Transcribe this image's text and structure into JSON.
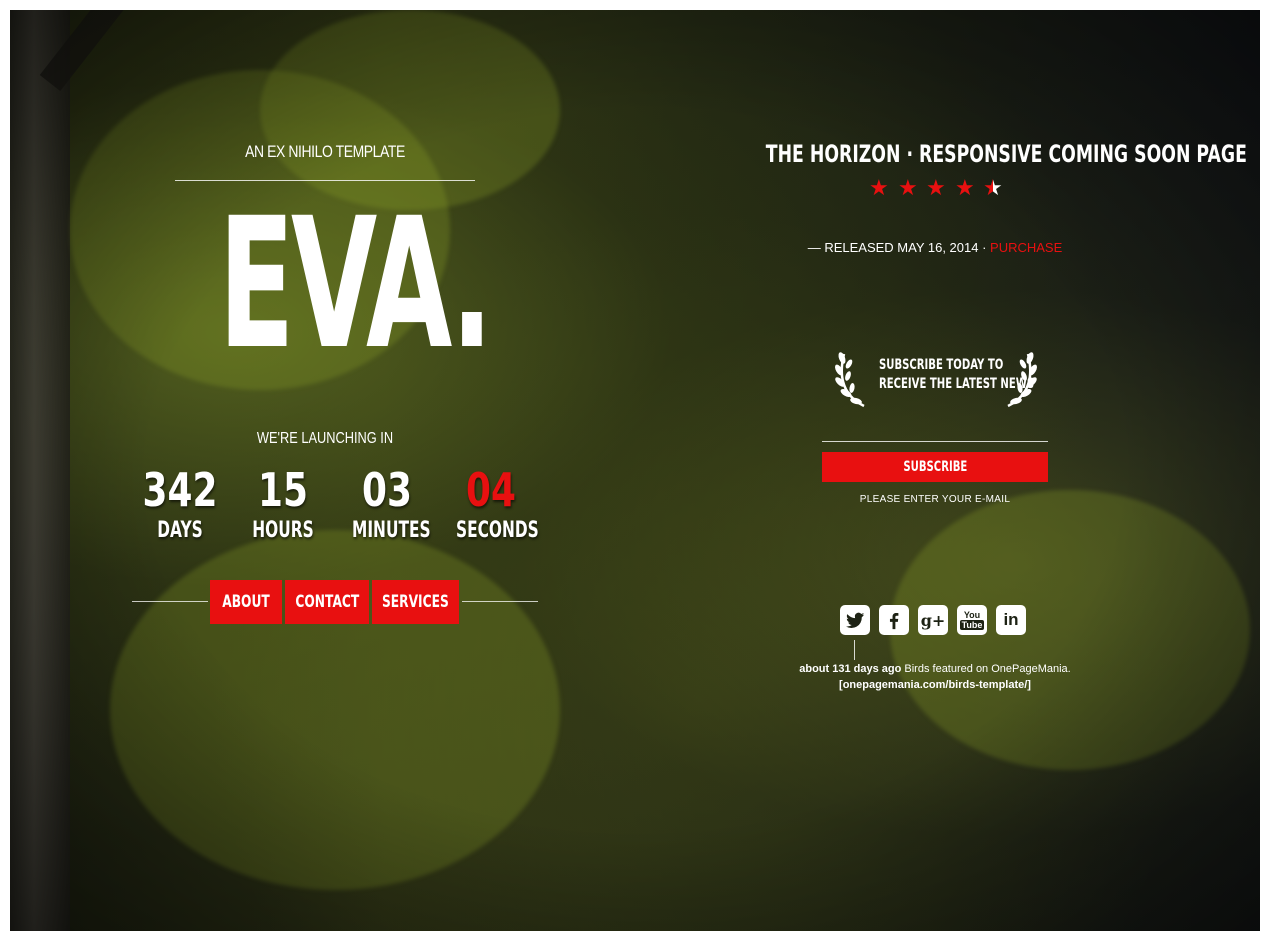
{
  "left": {
    "kicker": "AN EX NIHILO TEMPLATE",
    "brand": "EVA.",
    "launch_label": "WE'RE LAUNCHING IN",
    "countdown": [
      {
        "value": "342",
        "label": "DAYS"
      },
      {
        "value": "15",
        "label": "HOURS"
      },
      {
        "value": "03",
        "label": "MINUTES"
      },
      {
        "value": "04",
        "label": "SECONDS"
      }
    ],
    "nav": [
      {
        "label": "ABOUT"
      },
      {
        "label": "CONTACT"
      },
      {
        "label": "SERVICES"
      }
    ]
  },
  "right": {
    "product_title": "THE HORIZON · RESPONSIVE COMING SOON PAGE",
    "rating": 4.5,
    "rating_max": 5,
    "released_text": "— RELEASED MAY 16, 2014 · ",
    "purchase_label": "PURCHASE",
    "subscribe_line1": "SUBSCRIBE TODAY TO",
    "subscribe_line2": "RECEIVE THE LATEST NEWS",
    "email_value": "",
    "subscribe_button": "SUBSCRIBE",
    "email_hint": "PLEASE ENTER YOUR E-MAIL",
    "social": [
      {
        "icon": "twitter-icon"
      },
      {
        "icon": "facebook-icon"
      },
      {
        "icon": "google-plus-icon"
      },
      {
        "icon": "youtube-icon"
      },
      {
        "icon": "linkedin-icon"
      }
    ],
    "tweet_time": "about 131 days ago",
    "tweet_text": " Birds featured on OnePageMania.",
    "tweet_link": "[onepagemania.com/birds-template/]"
  },
  "colors": {
    "accent": "#e81010",
    "text": "#ffffff"
  }
}
